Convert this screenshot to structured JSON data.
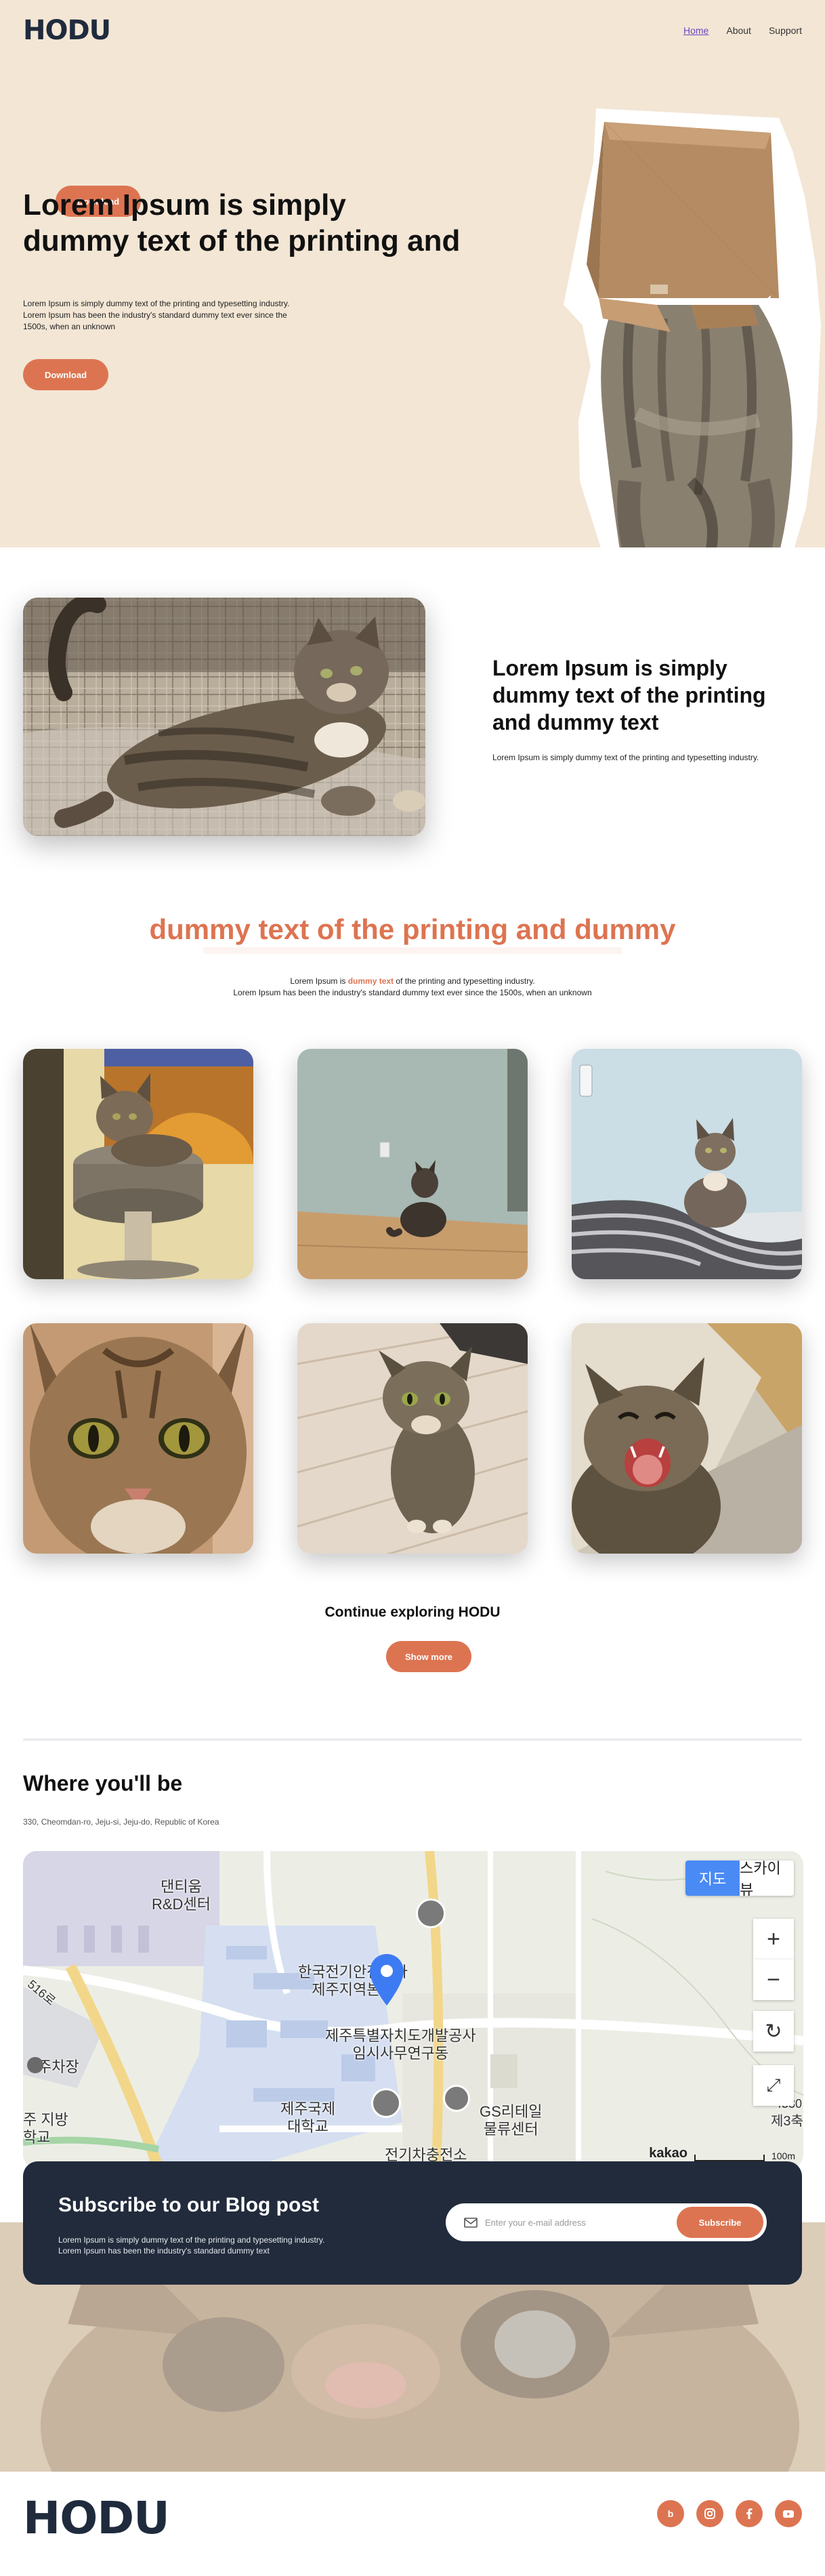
{
  "brand": {
    "logo": "HODU"
  },
  "nav": {
    "items": [
      {
        "label": "Home"
      },
      {
        "label": "About"
      },
      {
        "label": "Support"
      }
    ],
    "download_label": "Download"
  },
  "hero": {
    "title_line1": "Lorem Ipsum is simply",
    "title_line2": "dummy text of the printing and",
    "desc_line1": "Lorem Ipsum is simply dummy text of the printing and typesetting industry.",
    "desc_line2": "Lorem Ipsum has been the industry's standard dummy text ever since the 1500s, when an unknown",
    "download_label": "Download"
  },
  "feature": {
    "title": "Lorem Ipsum is simply dummy text of the printing and dummy text",
    "desc": "Lorem Ipsum is simply dummy text of the printing and typesetting industry."
  },
  "section": {
    "title": "dummy text of the printing and dummy",
    "desc_pre": "Lorem Ipsum is ",
    "desc_highlight": "dummy text",
    "desc_post": " of the printing and typesetting industry.",
    "desc_line2": "Lorem Ipsum has been the industry's standard dummy text ever since the 1500s, when an unknown"
  },
  "continue": {
    "title": "Continue exploring HODU",
    "button_label": "Show more"
  },
  "location": {
    "title": "Where you'll be",
    "address": "330, Cheomdan-ro, Jeju-si, Jeju-do, Republic of Korea",
    "map": {
      "toggle_map": "지도",
      "toggle_sky": "스카이뷰",
      "zoom_in": "+",
      "zoom_out": "−",
      "scale_brand": "kakao",
      "scale_label": "100m",
      "labels": {
        "rnd": "댄티움\nR&D센터",
        "kepco": "한국전기안전공사\n제주지역본부",
        "jdc": "제주특별자치도개발공사\n임시사무연구동",
        "jiu": "제주국제\n대학교",
        "gs": "GS리테일\n물류센터",
        "ev": "전기차충전소",
        "parking": "주차장",
        "school": "주 지방\n학교",
        "jeju3": "제3축",
        "num": "4530",
        "road": "516로",
        "west": "제주지",
        "bus": "미"
      }
    }
  },
  "subscribe": {
    "title": "Subscribe to our Blog post",
    "desc": "Lorem Ipsum is simply dummy text of the printing and typesetting industry. Lorem Ipsum has been the industry's standard dummy text",
    "placeholder": "Enter your e-mail address",
    "button_label": "Subscribe"
  },
  "footer": {
    "logo": "HODU",
    "social": [
      "blog-icon",
      "instagram-icon",
      "facebook-icon",
      "youtube-icon"
    ]
  },
  "colors": {
    "accent": "#dd7451",
    "dark": "#212b3c",
    "hero_bg": "#f3e6d5",
    "map_blue": "#4a8af4"
  }
}
